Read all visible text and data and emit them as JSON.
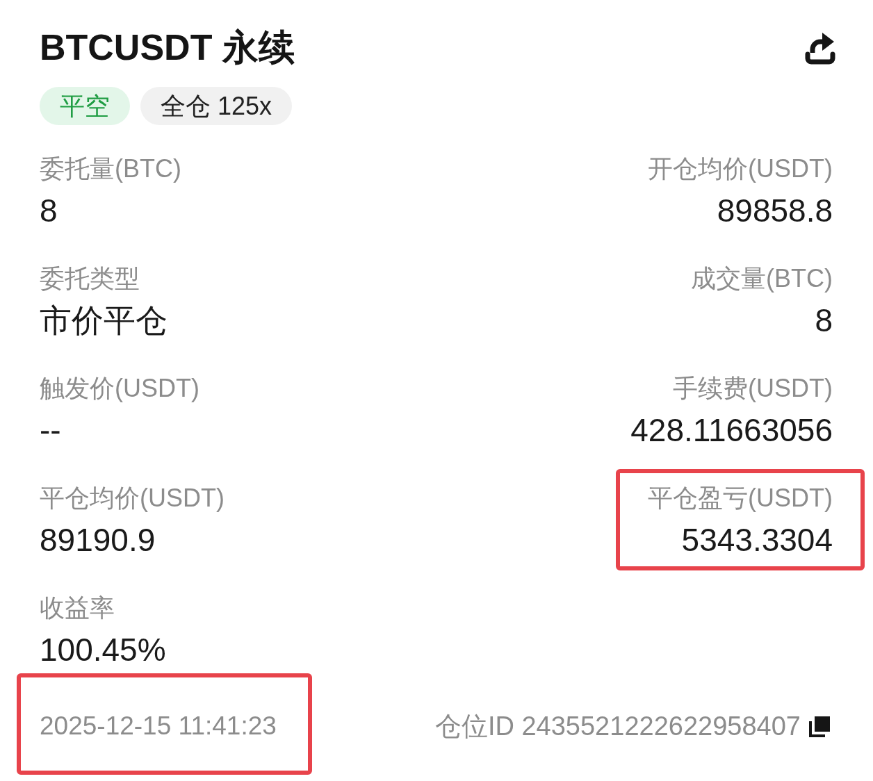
{
  "header": {
    "title": "BTCUSDT 永续"
  },
  "tags": [
    {
      "label": "平空",
      "kind": "side"
    },
    {
      "label": "全仓 125x",
      "kind": "mode"
    }
  ],
  "fields": [
    {
      "label": "委托量(BTC)",
      "value": "8",
      "highlighted": false
    },
    {
      "label": "开仓均价(USDT)",
      "value": "89858.8",
      "highlighted": false
    },
    {
      "label": "委托类型",
      "value": "市价平仓",
      "highlighted": false
    },
    {
      "label": "成交量(BTC)",
      "value": "8",
      "highlighted": false
    },
    {
      "label": "触发价(USDT)",
      "value": "--",
      "highlighted": false
    },
    {
      "label": "手续费(USDT)",
      "value": "428.11663056",
      "highlighted": false
    },
    {
      "label": "平仓均价(USDT)",
      "value": "89190.9",
      "highlighted": false
    },
    {
      "label": "平仓盈亏(USDT)",
      "value": "5343.3304",
      "highlighted": true
    },
    {
      "label": "收益率",
      "value": "100.45%",
      "highlighted": false
    }
  ],
  "footer": {
    "time": "2025-12-15 11:41:23",
    "time_highlighted": true,
    "position_id": "仓位ID 2435521222622958407"
  }
}
